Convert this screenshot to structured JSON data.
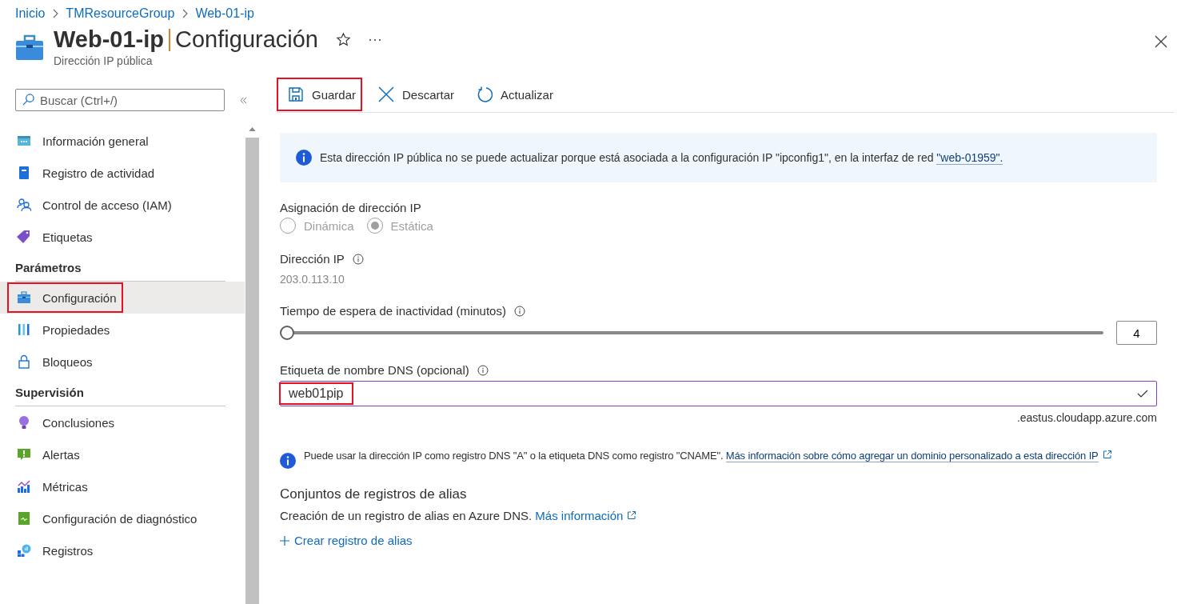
{
  "breadcrumb": [
    "Inicio",
    "TMResourceGroup",
    "Web-01-ip"
  ],
  "header": {
    "resource": "Web-01-ip",
    "page": "Configuración",
    "subtitle": "Dirección IP pública",
    "favorite": false
  },
  "sidebar": {
    "search": {
      "placeholder": "Buscar (Ctrl+/)"
    },
    "sections": [
      {
        "items": [
          {
            "label": "Información general",
            "selected": false,
            "highlighted": false
          },
          {
            "label": "Registro de actividad",
            "selected": false,
            "highlighted": false
          },
          {
            "label": "Control de acceso (IAM)",
            "selected": false,
            "highlighted": false
          },
          {
            "label": "Etiquetas",
            "selected": false,
            "highlighted": false
          }
        ]
      },
      {
        "heading": "Parámetros",
        "items": [
          {
            "label": "Configuración",
            "selected": true,
            "highlighted": true
          },
          {
            "label": "Propiedades",
            "selected": false,
            "highlighted": false
          },
          {
            "label": "Bloqueos",
            "selected": false,
            "highlighted": false
          }
        ]
      },
      {
        "heading": "Supervisión",
        "items": [
          {
            "label": "Conclusiones",
            "selected": false,
            "highlighted": false
          },
          {
            "label": "Alertas",
            "selected": false,
            "highlighted": false
          },
          {
            "label": "Métricas",
            "selected": false,
            "highlighted": false
          },
          {
            "label": "Configuración de diagnóstico",
            "selected": false,
            "highlighted": false
          },
          {
            "label": "Registros",
            "selected": false,
            "highlighted": false
          }
        ]
      }
    ]
  },
  "toolbar": [
    {
      "label": "Guardar",
      "kind": "save",
      "highlighted": true
    },
    {
      "label": "Descartar",
      "kind": "discard",
      "highlighted": false
    },
    {
      "label": "Actualizar",
      "kind": "refresh",
      "highlighted": false
    }
  ],
  "info_banner": {
    "text": "Esta dirección IP pública no se puede actualizar porque está asociada a la configuración IP \"ipconfig1\", en la interfaz de red ",
    "link": "\"web-01959\"."
  },
  "assignment": {
    "label": "Asignación de dirección IP",
    "disabled": true,
    "options": [
      {
        "label": "Dinámica",
        "selected": false
      },
      {
        "label": "Estática",
        "selected": true
      }
    ]
  },
  "ip_address": {
    "label": "Dirección IP",
    "value": "203.0.113.10"
  },
  "idle_timeout": {
    "label": "Tiempo de espera de inactividad (minutos)",
    "level": 0,
    "value": "4"
  },
  "dns_label": {
    "label": "Etiqueta de nombre DNS (opcional)",
    "value": "web01pip",
    "valid": true,
    "highlighted": true,
    "suffix": ".eastus.cloudapp.azure.com"
  },
  "dns_note": {
    "text": "Puede usar la dirección IP como registro DNS \"A\" o la etiqueta DNS como registro \"CNAME\". ",
    "link": "Más información sobre cómo agregar un dominio personalizado a esta dirección IP"
  },
  "alias": {
    "heading": "Conjuntos de registros de alias",
    "text": "Creación de un registro de alias en Azure DNS. ",
    "link": "Más información",
    "action": "Crear registro de alias"
  }
}
